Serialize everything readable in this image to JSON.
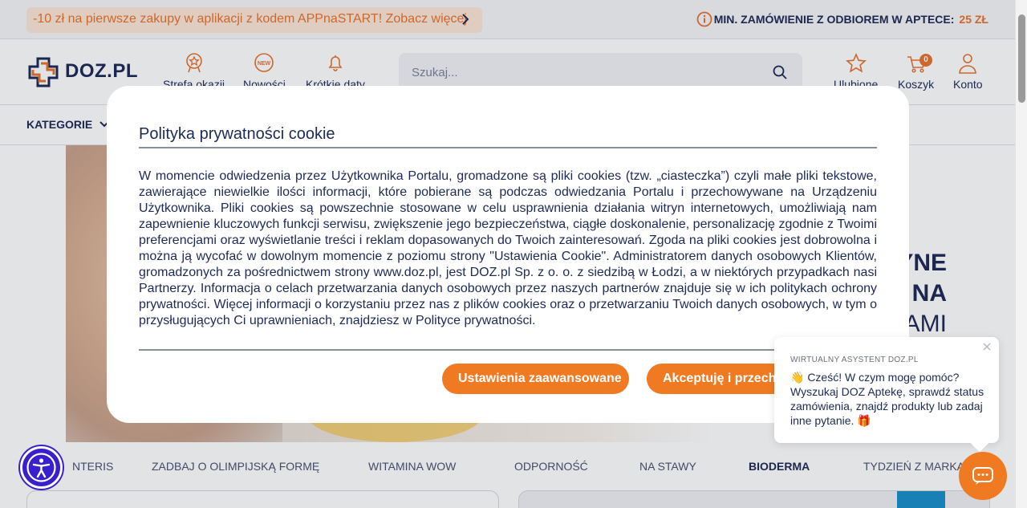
{
  "promo": {
    "text": "-10 zł na pierwsze zakupy w aplikacji z kodem APPnaSTART! Zobacz więcej"
  },
  "min_order": {
    "label": "MIN. ZAMÓWIENIE Z ODBIOREM W APTECE:",
    "value": "25 ZŁ"
  },
  "header": {
    "logo": "DOZ.PL",
    "nav": [
      {
        "label": "Strefa okazji",
        "icon": "medal-icon"
      },
      {
        "label": "Nowości",
        "icon": "new-badge-icon"
      },
      {
        "label": "Krótkie daty",
        "icon": "bell-icon"
      }
    ],
    "search_placeholder": "Szukaj...",
    "actions": {
      "favorites": "Ulubione",
      "cart": "Koszyk",
      "cart_count": "0",
      "account": "Konto"
    }
  },
  "categories": {
    "label": "KATEGORIE"
  },
  "hero": {
    "line1": "YNE",
    "line2": "NA",
    "line3": "AMI"
  },
  "tabs": [
    {
      "label": "NTERIS"
    },
    {
      "label": "ZADBAJ O OLIMPIJSKĄ FORMĘ"
    },
    {
      "label": "WITAMINA WOW"
    },
    {
      "label": "ODPORNOŚĆ"
    },
    {
      "label": "NA STAWY"
    },
    {
      "label": "BIODERMA",
      "active": true
    },
    {
      "label": "TYDZIEŃ Z MARKĄ"
    }
  ],
  "cookie_modal": {
    "title": "Polityka prywatności cookie",
    "body": "W momencie odwiedzenia przez Użytkownika Portalu, gromadzone są pliki cookies (tzw. „ciasteczka”) czyli małe pliki tekstowe, zawierające niewielkie ilości informacji, które pobierane są podczas odwiedzania Portalu i przechowywane na Urządzeniu Użytkownika. Pliki cookies są powszechnie stosowane w celu usprawnienia działania witryn internetowych, umożliwiają nam zapewnienie kluczowych funkcji serwisu, zwiększenie jego bezpieczeństwa, ciągłe doskonalenie, personalizację zgodnie z Twoimi preferencjami oraz wyświetlanie treści i reklam dopasowanych do Twoich zainteresowań. Zgoda na pliki cookies jest dobrowolna i można ją wycofać w dowolnym momencie z poziomu strony \"Ustawienia Cookie\". Administratorem danych osobowych Klientów, gromadzonych za pośrednictwem strony www.doz.pl, jest DOZ.pl Sp. z o. o. z siedzibą w Łodzi, a w niektórych przypadkach nasi Partnerzy. Informacja o celach przetwarzania danych osobowych przez naszych partnerów znajduje się w ich politykach ochrony prywatności. Więcej informacji o korzystaniu przez nas z plików cookies oraz o przetwarzaniu Twoich danych osobowych, w tym o przysługujących Ci uprawnieniach, znajdziesz w Polityce prywatności.",
    "btn_advanced": "Ustawienia zaawansowane",
    "btn_accept": "Akceptuję i przechodzę"
  },
  "chat": {
    "label": "WIRTUALNY ASYSTENT DOZ.PL",
    "message": "👋 Cześć! W czym mogę pomóc? Wyszukaj DOZ Aptekę, sprawdź status zamówienia, znajdź produkty lub zadaj inne pytanie. 🎁"
  },
  "colors": {
    "brand_orange": "#f07a22",
    "navy": "#1e2a55",
    "a11y_purple": "#3a1fcf"
  }
}
